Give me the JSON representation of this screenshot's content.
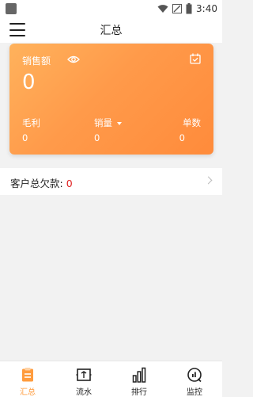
{
  "statusbar": {
    "time": "3:40"
  },
  "header": {
    "title": "汇总"
  },
  "card": {
    "sales_label": "销售额",
    "sales_value": "0",
    "stats": [
      {
        "label": "毛利",
        "value": "0"
      },
      {
        "label": "销量",
        "value": "0"
      },
      {
        "label": "单数",
        "value": "0"
      }
    ]
  },
  "debt": {
    "label": "客户总欠款:",
    "value": "0"
  },
  "tabs": [
    {
      "label": "汇总",
      "icon": "clipboard-icon",
      "active": true
    },
    {
      "label": "流水",
      "icon": "transfer-icon",
      "active": false
    },
    {
      "label": "排行",
      "icon": "bar-chart-icon",
      "active": false
    },
    {
      "label": "监控",
      "icon": "monitor-icon",
      "active": false
    }
  ],
  "colors": {
    "accent": "#ff9c3e",
    "debt_value": "#e02020",
    "card_start": "#ffb25c",
    "card_end": "#ff8b3b"
  }
}
